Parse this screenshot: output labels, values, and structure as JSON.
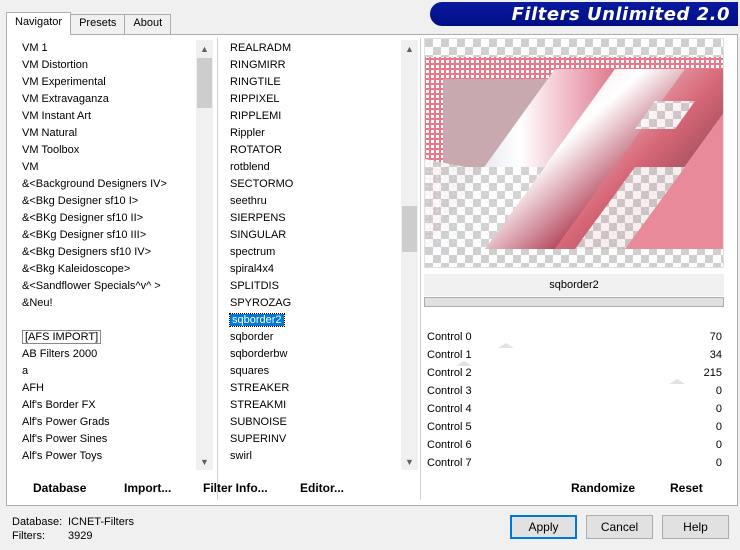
{
  "banner": {
    "title": "Filters Unlimited 2.0"
  },
  "tabs": [
    {
      "label": "Navigator",
      "active": true
    },
    {
      "label": "Presets",
      "active": false
    },
    {
      "label": "About",
      "active": false
    }
  ],
  "categories": [
    "VM 1",
    "VM Distortion",
    "VM Experimental",
    "VM Extravaganza",
    "VM Instant Art",
    "VM Natural",
    "VM Toolbox",
    "VM",
    "&<Background Designers IV>",
    "&<Bkg Designer sf10 I>",
    "&<BKg Designer sf10 II>",
    "&<BKg Designer sf10 III>",
    "&<Bkg Designers sf10 IV>",
    "&<Bkg Kaleidoscope>",
    "&<Sandflower Specials^v^ >",
    "&Neu!",
    "",
    "[AFS IMPORT]",
    "AB Filters 2000",
    "a",
    "AFH",
    "Alf's Border FX",
    "Alf's Power Grads",
    "Alf's Power Sines",
    "Alf's Power Toys"
  ],
  "filters": [
    "REALRADM",
    "RINGMIRR",
    "RINGTILE",
    "RIPPIXEL",
    "RIPPLEMI",
    "Rippler",
    "ROTATOR",
    "rotblend",
    "SECTORMO",
    "seethru",
    "SIERPENS",
    "SINGULAR",
    "spectrum",
    "spiral4x4",
    "SPLITDIS",
    "SPYROZAG",
    "sqborder2",
    "sqborder",
    "sqborderbw",
    "squares",
    "STREAKER",
    "STREAKMI",
    "SUBNOISE",
    "SUPERINV",
    "swirl"
  ],
  "selected_filter": "sqborder2",
  "current_filter_name": "sqborder2",
  "controls": [
    {
      "label": "Control 0",
      "value": "70",
      "level": 70
    },
    {
      "label": "Control 1",
      "value": "34",
      "level": 34
    },
    {
      "label": "Control 2",
      "value": "215",
      "level": 215
    },
    {
      "label": "Control 3",
      "value": "0",
      "level": 0
    },
    {
      "label": "Control 4",
      "value": "0",
      "level": 0
    },
    {
      "label": "Control 5",
      "value": "0",
      "level": 0
    },
    {
      "label": "Control 6",
      "value": "0",
      "level": 0
    },
    {
      "label": "Control 7",
      "value": "0",
      "level": 0
    }
  ],
  "toolbar": {
    "database": "Database",
    "import": "Import...",
    "filter_info": "Filter Info...",
    "editor": "Editor...",
    "randomize": "Randomize",
    "reset": "Reset"
  },
  "status": {
    "database_label": "Database:",
    "database_value": "ICNET-Filters",
    "filters_label": "Filters:",
    "filters_value": "3929"
  },
  "buttons": {
    "apply": "Apply",
    "cancel": "Cancel",
    "help": "Help"
  },
  "colors": {
    "accent": "#0078d7",
    "banner": "#000e85",
    "preview_pink": "#e8788a"
  },
  "icons": [
    "scroll-up-arrow-icon",
    "scroll-down-arrow-icon"
  ]
}
